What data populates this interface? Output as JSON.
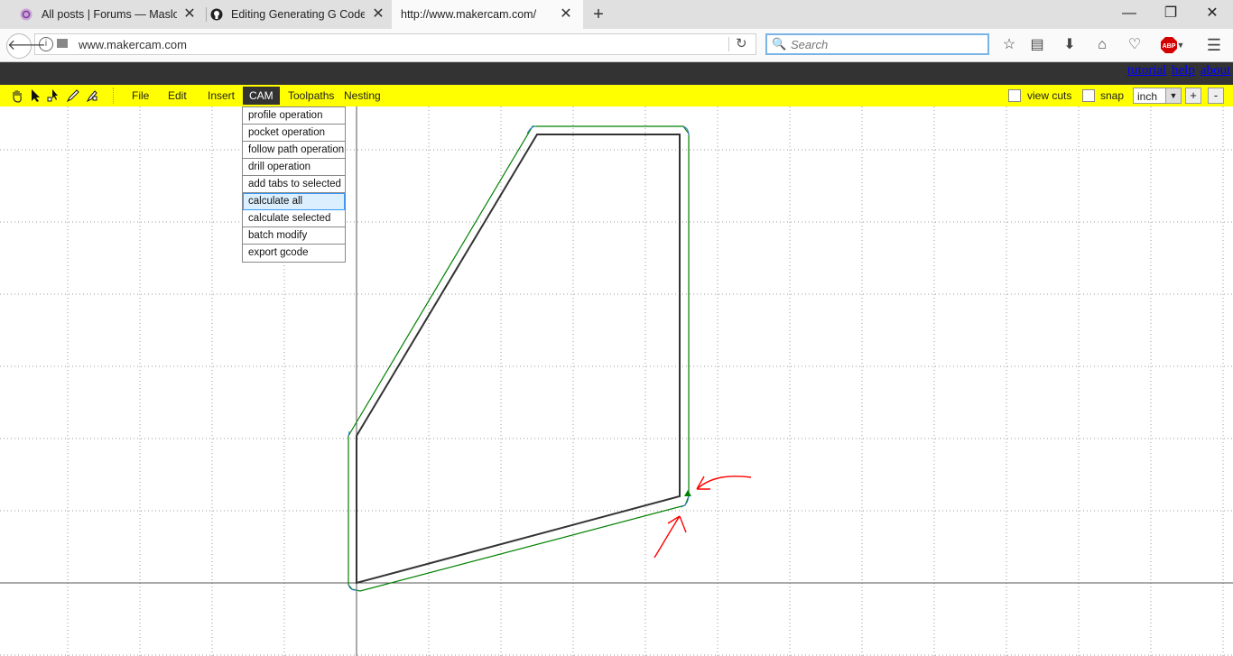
{
  "browser": {
    "tabs": [
      {
        "title": "All posts | Forums — Maslov",
        "active": false
      },
      {
        "title": "Editing Generating G Code U",
        "active": false
      },
      {
        "title": "http://www.makercam.com/",
        "active": true
      }
    ],
    "url": "www.makercam.com",
    "search_placeholder": "Search",
    "close_glyph": "✕",
    "new_tab_glyph": "+",
    "window_controls": {
      "minimize": "—",
      "restore": "❐",
      "close": "✕"
    }
  },
  "app": {
    "header_links": [
      "tutorial",
      "help",
      "about"
    ],
    "menus": [
      "File",
      "Edit",
      "Insert",
      "CAM",
      "Toolpaths",
      "Nesting"
    ],
    "active_menu": "CAM",
    "options": {
      "view_cuts_label": "view cuts",
      "snap_label": "snap"
    },
    "unit": "inch",
    "zoom_in": "+",
    "zoom_out": "-",
    "cam_menu_items": [
      "profile operation",
      "pocket operation",
      "follow path operation",
      "drill operation",
      "add tabs to selected",
      "calculate all",
      "calculate selected",
      "batch modify",
      "export gcode"
    ],
    "highlighted_item": "calculate all"
  },
  "colors": {
    "menubar": "#ffff00",
    "header": "#333333",
    "shape": "#333333",
    "toolpath": "#008000",
    "annotation": "#ff0000"
  }
}
